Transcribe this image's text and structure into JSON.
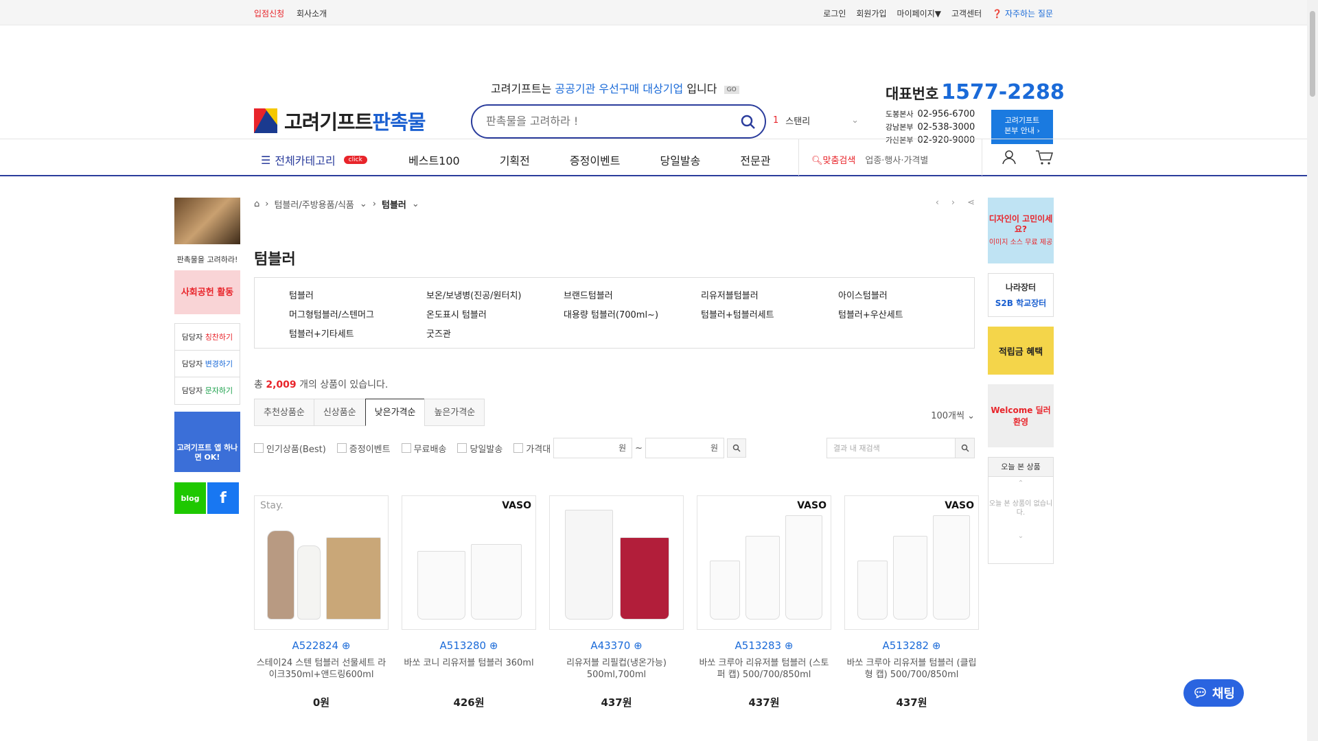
{
  "topbar": {
    "left": [
      "입점신청",
      "회사소개"
    ],
    "right": [
      "로그인",
      "회원가입",
      "마이페이지▼",
      "고객센터"
    ],
    "faq": "자주하는 질문"
  },
  "logo": {
    "main": "고려기프트",
    "accent": "판촉물"
  },
  "promo": {
    "pre": "고려기프트는",
    "highlight": "공공기관 우선구매 대상기업",
    "post": "입니다",
    "go": "GO"
  },
  "search": {
    "placeholder": "판촉물을 고려하라 !"
  },
  "ranking": {
    "num": "1",
    "term": "스탠리"
  },
  "contact": {
    "label": "대표번호",
    "phone": "1577-2288",
    "branches": [
      {
        "name": "도봉본사",
        "tel": "02-956-6700"
      },
      {
        "name": "강남본부",
        "tel": "02-538-3000"
      },
      {
        "name": "가산본부",
        "tel": "02-920-9000"
      }
    ],
    "hq_btn_1": "고려기프트",
    "hq_btn_2": "본부 안내 ›"
  },
  "gnb": {
    "all_cat": "전체카테고리",
    "click": "click",
    "menu": [
      "베스트100",
      "기획전",
      "증정이벤트",
      "당일발송",
      "전문관"
    ],
    "fit_key": "맞춤검색",
    "fit_val": "업종·행사·가격별"
  },
  "left": {
    "caption": "판촉물을 고려하라!",
    "social": "사회공헌 활동",
    "btns": [
      {
        "pre": "담당자 ",
        "key": "칭찬하기",
        "color": "#e8242a"
      },
      {
        "pre": "담당자 ",
        "key": "변경하기",
        "color": "#1a6ad8"
      },
      {
        "pre": "담당자 ",
        "key": "문자하기",
        "color": "#1aa04a"
      }
    ],
    "app": "고려기프트 앱 하나면 OK!",
    "blog": "blog",
    "fb": "f"
  },
  "breadcrumb": {
    "c1": "텀블러/주방용품/식품",
    "c2": "텀블러"
  },
  "page_title": "텀블러",
  "subcats": [
    "텀블러",
    "보온/보냉병(진공/원터치)",
    "브랜드텀블러",
    "리유저블텀블러",
    "아이스텀블러",
    "머그형텀블러/스텐머그",
    "온도표시 텀블러",
    "대용량 텀블러(700ml~)",
    "텀블러+텀블러세트",
    "텀블러+우산세트",
    "텀블러+기타세트",
    "굿즈관"
  ],
  "count": {
    "pre": "총",
    "num": "2,009",
    "post": "개의 상품이 있습니다."
  },
  "sort_tabs": [
    "추천상품순",
    "신상품순",
    "낮은가격순",
    "높은가격순"
  ],
  "per_page": "100개씩",
  "filters": [
    "인기상품(Best)",
    "증정이벤트",
    "무료배송",
    "당일발송",
    "가격대"
  ],
  "price_unit": "원",
  "tilde": "~",
  "result_search": "결과 내 재검색",
  "products": [
    {
      "code": "A522824",
      "name": "스테이24 스텐 텀블러 선물세트 라이크350ml+앤드링600ml",
      "price": "0원",
      "brand": "Stay."
    },
    {
      "code": "A513280",
      "name": "바쏘 코니 리유저블 텀블러 360ml",
      "price": "426원",
      "brand": "VASO"
    },
    {
      "code": "A43370",
      "name": "리유저블 리필컵(냉온가능) 500ml,700ml",
      "price": "437원",
      "brand": ""
    },
    {
      "code": "A513283",
      "name": "바쏘 크루아 리유저블 텀블러 (스토퍼 캡) 500/700/850ml",
      "price": "437원",
      "brand": "VASO"
    },
    {
      "code": "A513282",
      "name": "바쏘 크루아 리유저블 텀블러 (클립형 캡) 500/700/850ml",
      "price": "437원",
      "brand": "VASO"
    }
  ],
  "right": {
    "design": "디자인이 고민이세요?",
    "design_sub": "이미지 소스 무료 제공",
    "nara": "나라장터",
    "s2b": "S2B 학교장터",
    "point": "적립금 혜택",
    "welcome": "Welcome 딜러환영",
    "recent_title": "오늘 본 상품",
    "recent_empty": "오늘 본 상품이 없습니다."
  },
  "chat": "채팅"
}
